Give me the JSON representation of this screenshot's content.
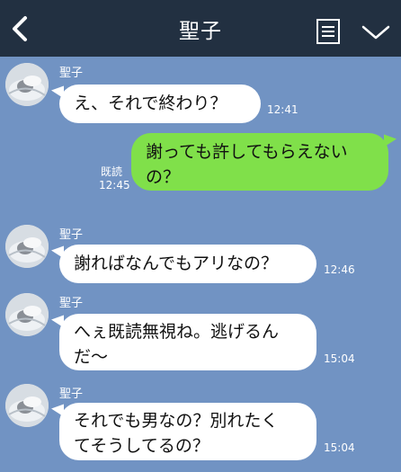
{
  "header": {
    "title": "聖子",
    "back_icon": "chevron-left-icon",
    "menu_icon": "document-list-icon",
    "collapse_icon": "chevron-down-icon",
    "background": "#223041"
  },
  "chat": {
    "background": "#7193c3",
    "messages": [
      {
        "sender": "聖子",
        "text": "え、それで終わり？",
        "time": "12:41",
        "direction": "incoming"
      },
      {
        "text": "謝っても許してもらえない\nの？",
        "time": "12:45",
        "read_label": "既読",
        "direction": "outgoing",
        "bubble_color": "#80e04a"
      },
      {
        "sender": "聖子",
        "text": "謝ればなんでもアリなの？",
        "time": "12:46",
        "direction": "incoming"
      },
      {
        "sender": "聖子",
        "text": "へぇ既読無視ね。逃げるん\nだ〜",
        "time": "15:04",
        "direction": "incoming"
      },
      {
        "sender": "聖子",
        "text": "それでも男なの？別れたく\nてそうしてるの？",
        "time": "15:04",
        "direction": "incoming"
      }
    ]
  }
}
